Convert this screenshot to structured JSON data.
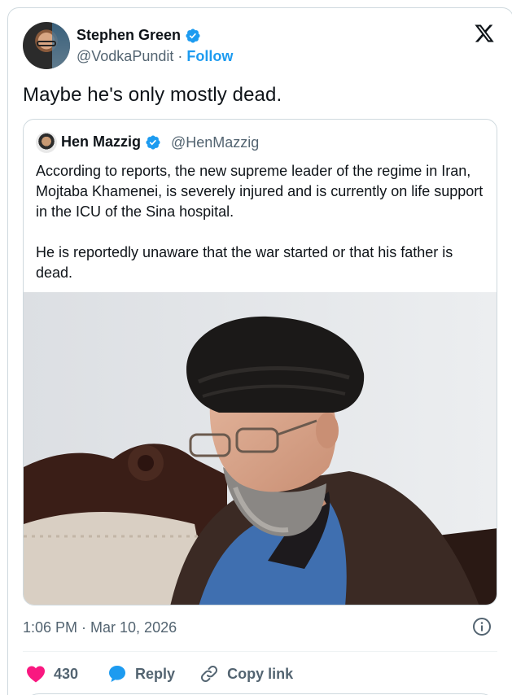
{
  "tweet": {
    "author_name": "Stephen Green",
    "handle": "@VodkaPundit",
    "separator": " · ",
    "follow_label": "Follow",
    "text": "Maybe he's only mostly dead.",
    "timestamp": "1:06 PM · Mar 10, 2026"
  },
  "quoted": {
    "author_name": "Hen Mazzig",
    "handle": "@HenMazzig",
    "text": "According to reports, the new supreme leader of the regime in Iran, Mojtaba Khamenei, is severely injured and is currently on life support in the ICU of the Sina hospital.\n\nHe is reportedly unaware that the war started or that his father is dead."
  },
  "actions": {
    "like_count": "430",
    "reply_label": "Reply",
    "copy_label": "Copy link"
  },
  "colors": {
    "accent": "#1d9bf0",
    "like": "#f91880",
    "text": "#0f1419",
    "muted": "#536471",
    "border": "#cfd9de"
  },
  "icons": [
    "verified-badge-icon",
    "x-logo-icon",
    "info-icon",
    "heart-icon",
    "reply-bubble-icon",
    "link-icon"
  ]
}
